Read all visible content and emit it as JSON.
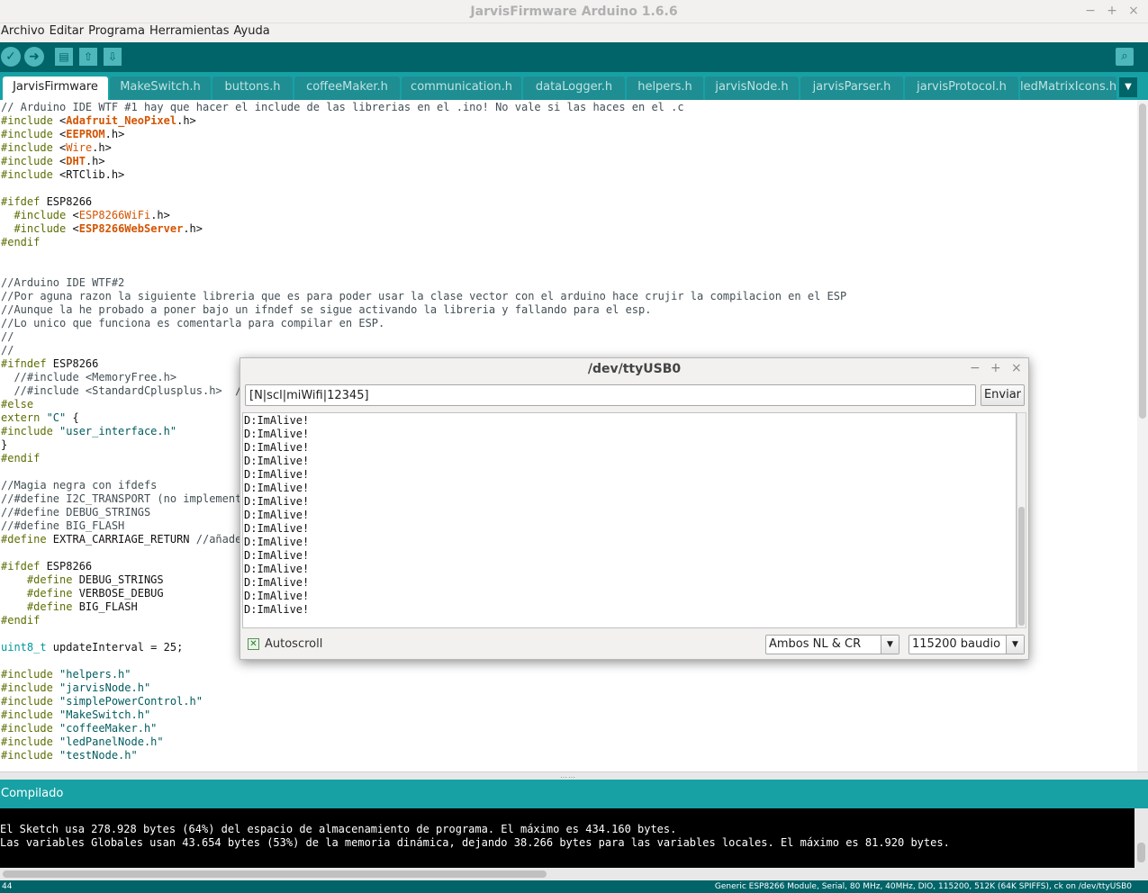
{
  "window": {
    "title": "JarvisFirmware Arduino 1.6.6",
    "minimize": "−",
    "maximize": "+",
    "close": "×"
  },
  "menu": [
    "Archivo",
    "Editar",
    "Programa",
    "Herramientas",
    "Ayuda"
  ],
  "toolbar": {
    "verify_icon": "check-icon",
    "upload_icon": "arrow-right-icon",
    "new_icon": "document-icon",
    "open_icon": "arrow-up-icon",
    "save_icon": "arrow-down-icon",
    "serial_icon": "magnifier-icon"
  },
  "tabs": [
    "JarvisFirmware",
    "MakeSwitch.h",
    "buttons.h",
    "coffeeMaker.h",
    "communication.h",
    "dataLogger.h",
    "helpers.h",
    "jarvisNode.h",
    "jarvisParser.h",
    "jarvisProtocol.h",
    "ledMatrixIcons.h"
  ],
  "editor": {
    "lines": [
      [
        [
          "cmt",
          "// Arduino IDE WTF #1 hay que hacer el include de las librerias en el .ino! No vale si las haces en el .c"
        ]
      ],
      [
        [
          "pp",
          "#include "
        ],
        [
          "",
          "<"
        ],
        [
          "lib",
          "Adafruit_NeoPixel"
        ],
        [
          "",
          ".h>"
        ]
      ],
      [
        [
          "pp",
          "#include "
        ],
        [
          "",
          "<"
        ],
        [
          "lib",
          "EEPROM"
        ],
        [
          "",
          ".h>"
        ]
      ],
      [
        [
          "pp",
          "#include "
        ],
        [
          "",
          "<"
        ],
        [
          "libn",
          "Wire"
        ],
        [
          "",
          ".h>"
        ]
      ],
      [
        [
          "pp",
          "#include "
        ],
        [
          "",
          "<"
        ],
        [
          "lib",
          "DHT"
        ],
        [
          "",
          ".h>"
        ]
      ],
      [
        [
          "pp",
          "#include "
        ],
        [
          "",
          "<RTClib.h>"
        ]
      ],
      [],
      [
        [
          "pp",
          "#ifdef "
        ],
        [
          "",
          "ESP8266"
        ]
      ],
      [
        [
          "pp",
          "  #include "
        ],
        [
          "",
          "<"
        ],
        [
          "libn",
          "ESP8266WiFi"
        ],
        [
          "",
          ".h>"
        ]
      ],
      [
        [
          "pp",
          "  #include "
        ],
        [
          "",
          "<"
        ],
        [
          "lib",
          "ESP8266WebServer"
        ],
        [
          "",
          ".h>"
        ]
      ],
      [
        [
          "pp",
          "#endif"
        ]
      ],
      [],
      [],
      [
        [
          "cmt",
          "//Arduino IDE WTF#2"
        ]
      ],
      [
        [
          "cmt",
          "//Por aguna razon la siguiente libreria que es para poder usar la clase vector con el arduino hace crujir la compilacion en el ESP"
        ]
      ],
      [
        [
          "cmt",
          "//Aunque la he probado a poner bajo un ifndef se sigue activando la libreria y fallando para el esp."
        ]
      ],
      [
        [
          "cmt",
          "//Lo unico que funciona es comentarla para compilar en ESP."
        ]
      ],
      [
        [
          "cmt",
          "//"
        ]
      ],
      [
        [
          "cmt",
          "//"
        ]
      ],
      [
        [
          "pp",
          "#ifndef "
        ],
        [
          "",
          "ESP8266"
        ]
      ],
      [
        [
          "cmt",
          "  //#include <MemoryFree.h>"
        ]
      ],
      [
        [
          "cmt",
          "  //#include <StandardCplusplus.h>  //"
        ]
      ],
      [
        [
          "pp",
          "#else"
        ]
      ],
      [
        [
          "pp",
          "extern "
        ],
        [
          "str",
          "\"C\""
        ],
        [
          "",
          " {"
        ]
      ],
      [
        [
          "pp",
          "#include "
        ],
        [
          "str",
          "\"user_interface.h\""
        ]
      ],
      [
        [
          "",
          "}"
        ]
      ],
      [
        [
          "pp",
          "#endif"
        ]
      ],
      [],
      [
        [
          "cmt",
          "//Magia negra con ifdefs"
        ]
      ],
      [
        [
          "cmt",
          "//#define I2C_TRANSPORT (no implementa"
        ]
      ],
      [
        [
          "cmt",
          "//#define DEBUG_STRINGS"
        ]
      ],
      [
        [
          "cmt",
          "//#define BIG_FLASH"
        ]
      ],
      [
        [
          "pp",
          "#define "
        ],
        [
          "",
          "EXTRA_CARRIAGE_RETURN "
        ],
        [
          "cmt",
          "//añade"
        ]
      ],
      [],
      [
        [
          "pp",
          "#ifdef "
        ],
        [
          "",
          "ESP8266"
        ]
      ],
      [
        [
          "pp",
          "    #define "
        ],
        [
          "",
          "DEBUG_STRINGS"
        ]
      ],
      [
        [
          "pp",
          "    #define "
        ],
        [
          "",
          "VERBOSE_DEBUG"
        ]
      ],
      [
        [
          "pp",
          "    #define "
        ],
        [
          "",
          "BIG_FLASH"
        ]
      ],
      [
        [
          "pp",
          "#endif"
        ]
      ],
      [],
      [
        [
          "type",
          "uint8_t"
        ],
        [
          "",
          " updateInterval = 25;"
        ]
      ],
      [],
      [
        [
          "pp",
          "#include "
        ],
        [
          "str",
          "\"helpers.h\""
        ]
      ],
      [
        [
          "pp",
          "#include "
        ],
        [
          "str",
          "\"jarvisNode.h\""
        ]
      ],
      [
        [
          "pp",
          "#include "
        ],
        [
          "str",
          "\"simplePowerControl.h\""
        ]
      ],
      [
        [
          "pp",
          "#include "
        ],
        [
          "str",
          "\"MakeSwitch.h\""
        ]
      ],
      [
        [
          "pp",
          "#include "
        ],
        [
          "str",
          "\"coffeeMaker.h\""
        ]
      ],
      [
        [
          "pp",
          "#include "
        ],
        [
          "str",
          "\"ledPanelNode.h\""
        ]
      ],
      [
        [
          "pp",
          "#include "
        ],
        [
          "str",
          "\"testNode.h\""
        ]
      ]
    ]
  },
  "status": "Compilado",
  "console_lines": [
    "El Sketch usa 278.928 bytes (64%) del espacio de almacenamiento de programa. El máximo es 434.160 bytes.",
    "Las variables Globales usan 43.654 bytes (53%) de la memoria dinámica, dejando 38.266 bytes para las variables locales. El máximo es 81.920 bytes."
  ],
  "bottom": {
    "line_number": "44",
    "board": "Generic ESP8266 Module, Serial, 80 MHz, 40MHz, DIO, 115200, 512K (64K SPIFFS), ck on /dev/ttyUSB0"
  },
  "serial_monitor": {
    "title": "/dev/ttyUSB0",
    "input_value": "[N|scl|miWifi|12345]",
    "send_label": "Enviar",
    "output_lines": [
      "D:ImAlive!",
      "D:ImAlive!",
      "D:ImAlive!",
      "D:ImAlive!",
      "D:ImAlive!",
      "D:ImAlive!",
      "D:ImAlive!",
      "D:ImAlive!",
      "D:ImAlive!",
      "D:ImAlive!",
      "D:ImAlive!",
      "D:ImAlive!",
      "D:ImAlive!",
      "D:ImAlive!",
      "D:ImAlive!"
    ],
    "autoscroll_label": "Autoscroll",
    "autoscroll_checked": true,
    "line_ending": "Ambos NL & CR",
    "baud_rate": "115200 baudio"
  }
}
